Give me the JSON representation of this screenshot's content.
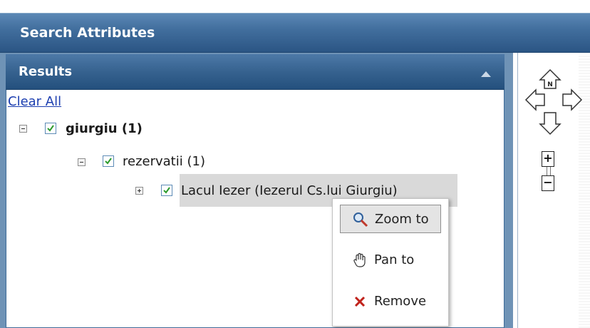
{
  "app": {
    "title": "Search Attributes"
  },
  "results_panel": {
    "title": "Results",
    "clear_all": "Clear All"
  },
  "tree": {
    "nodes": [
      {
        "label": "giurgiu (1)",
        "checked": true,
        "expanded": true
      },
      {
        "label": "rezervatii (1)",
        "checked": true,
        "expanded": true
      },
      {
        "label": "Lacul Iezer (Iezerul Cs.lui Giurgiu)",
        "checked": true,
        "expanded": false
      }
    ]
  },
  "context_menu": {
    "items": [
      {
        "label": "Zoom to",
        "icon": "magnifier-zoom-icon"
      },
      {
        "label": "Pan to",
        "icon": "hand-pan-icon"
      },
      {
        "label": "Remove",
        "icon": "red-x-remove-icon"
      }
    ]
  },
  "map_nav": {
    "north_label": "N",
    "zoom_in": "+",
    "zoom_out": "−"
  }
}
